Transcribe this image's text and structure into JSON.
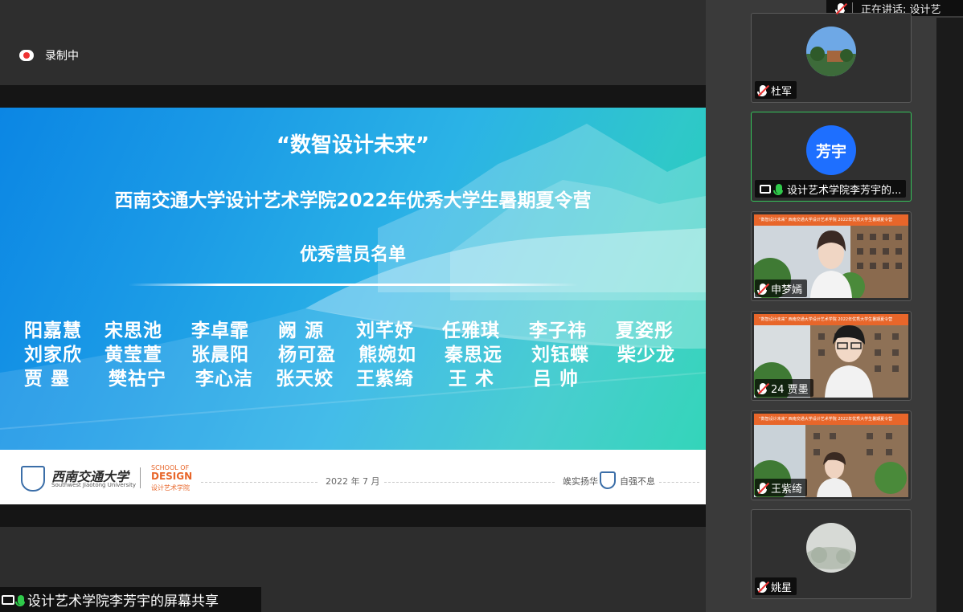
{
  "recording": {
    "label": "录制中"
  },
  "slide": {
    "quote": "“数智设计未来”",
    "main_title": "西南交通大学设计艺术学院2022年优秀大学生暑期夏令营",
    "subtitle": "优秀营员名单",
    "names": [
      [
        "阳嘉慧",
        "宋思池",
        "李卓霏",
        "阙 源",
        "刘芊妤",
        "任雅琪",
        "李子祎",
        "夏姿彤"
      ],
      [
        "刘家欣",
        "黄莹萱",
        "张晨阳",
        "杨可盈",
        "熊婉如",
        "秦思远",
        "刘钰蝶",
        "柴少龙"
      ],
      [
        "贾 墨",
        "樊祜宁",
        "李心洁",
        "张天姣",
        "王紫绮",
        "王 术",
        "吕 帅"
      ]
    ],
    "footer": {
      "university_cn": "西南交通大学",
      "university_en": "Southwest Jiaotong University",
      "school_en_a": "SCHOOL OF",
      "school_en_b": "DESIGN",
      "school_cn": "设计艺术学院",
      "date": "2022 年 7 月",
      "motto_a": "竢实扬华",
      "motto_b": "自强不息"
    }
  },
  "share_label": "设计艺术学院李芳宇的屏幕共享",
  "speaking": {
    "label": "正在讲话: 设计艺"
  },
  "participants": [
    {
      "name": "杜军",
      "kind": "photo",
      "muted": true
    },
    {
      "name": "设计艺术学院李芳宇的...",
      "kind": "initials",
      "initials": "芳宇",
      "muted": false,
      "sharing": true,
      "active": true
    },
    {
      "name": "申梦嫣",
      "kind": "video",
      "muted": true
    },
    {
      "name": "24 贾墨",
      "kind": "video",
      "muted": true
    },
    {
      "name": "王紫绮",
      "kind": "video",
      "muted": true
    },
    {
      "name": "姚星",
      "kind": "photo",
      "muted": true
    }
  ],
  "video_banner": "“数智设计未来” 西南交通大学设计艺术学院 2022年优秀大学生暑期夏令营",
  "colors": {
    "accent_green": "#2fc94a",
    "avatar_blue": "#1e6fff",
    "slide_orange": "#e8662a"
  }
}
